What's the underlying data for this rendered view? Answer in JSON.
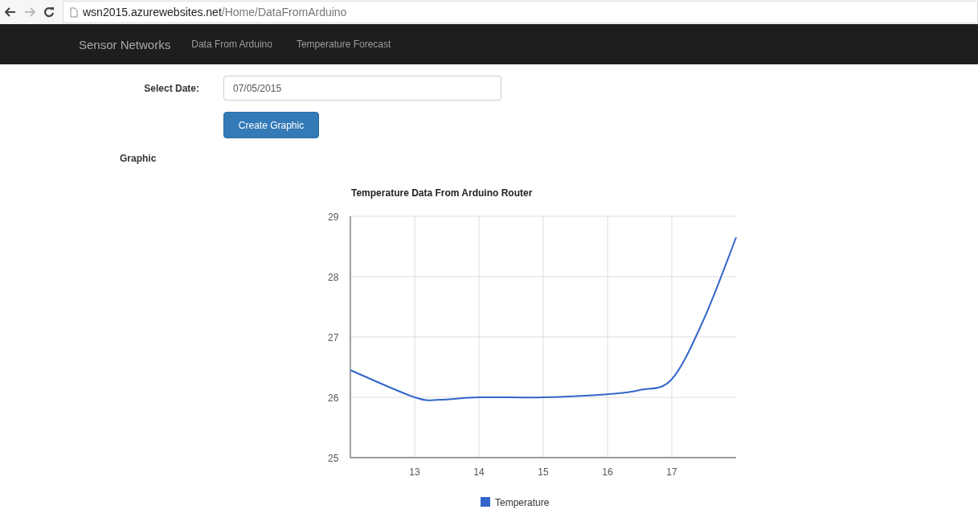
{
  "browser": {
    "url_host": "wsn2015.azurewebsites.net",
    "url_path": "/Home/DataFromArduino"
  },
  "navbar": {
    "brand": "Sensor Networks",
    "links": [
      "Data From Arduino",
      "Temperature Forecast"
    ]
  },
  "form": {
    "label": "Select Date:",
    "date_value": "07/05/2015",
    "button": "Create Graphic"
  },
  "section_title": "Graphic",
  "chart_data": {
    "type": "line",
    "title": "Temperature Data From Arduino Router",
    "x": [
      12,
      13,
      13.4,
      14,
      15,
      16,
      16.5,
      17,
      17.5,
      18
    ],
    "series": [
      {
        "name": "Temperature",
        "color": "#3366cc",
        "values": [
          26.45,
          26.0,
          25.96,
          26.0,
          26.0,
          26.05,
          26.12,
          26.3,
          27.3,
          28.65
        ]
      }
    ],
    "xlim": [
      12,
      18
    ],
    "ylim": [
      25,
      29
    ],
    "xticks": [
      13,
      14,
      15,
      16,
      17
    ],
    "yticks": [
      25,
      26,
      27,
      28,
      29
    ],
    "grid": true
  }
}
